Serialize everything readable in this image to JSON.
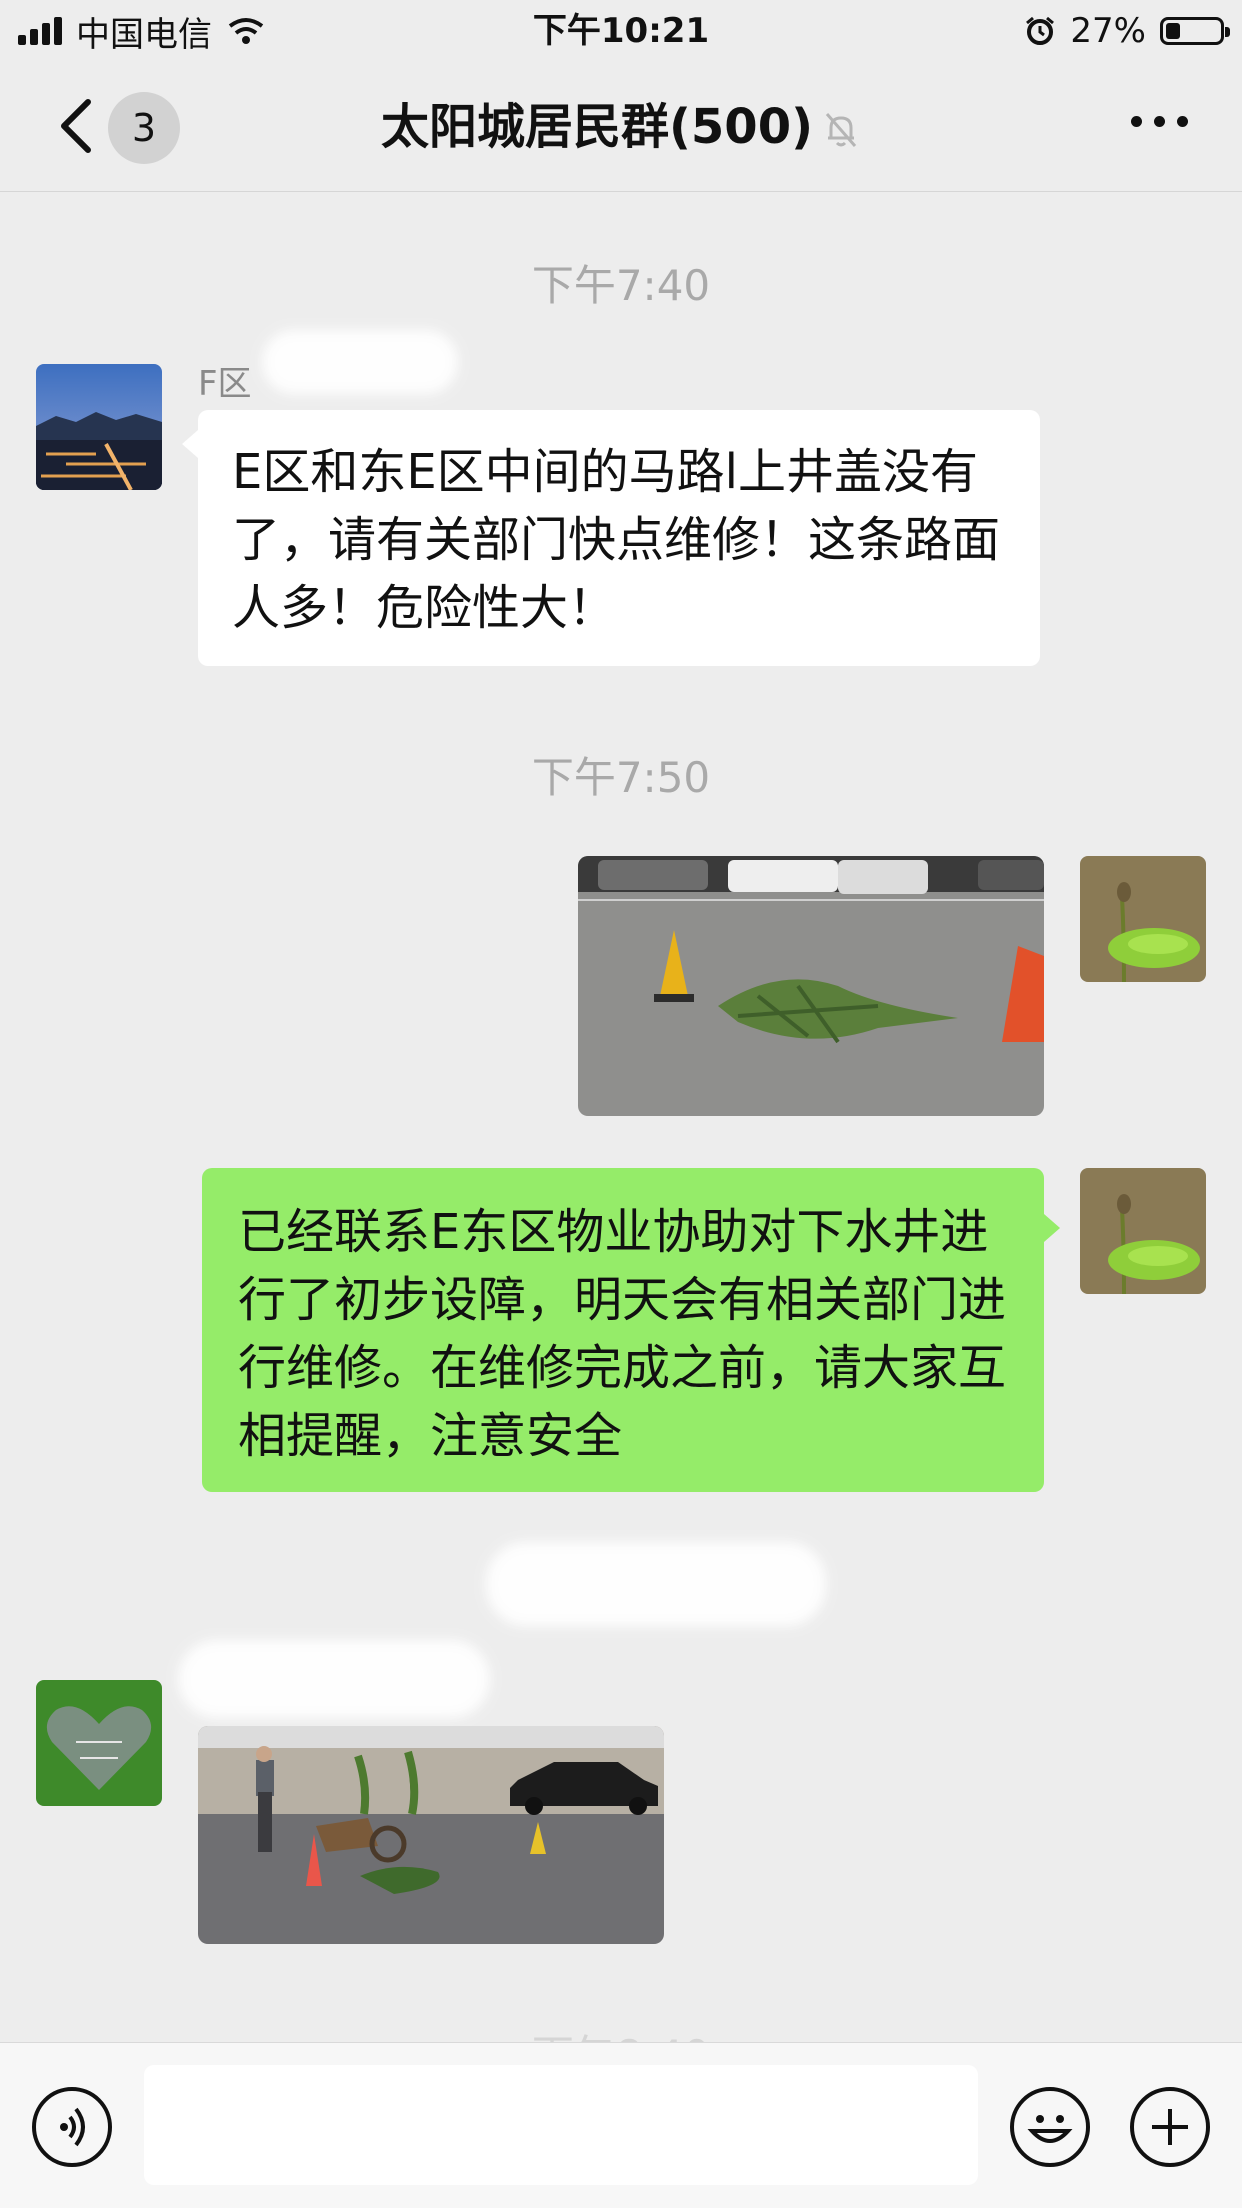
{
  "status_bar": {
    "carrier": "中国电信",
    "time": "下午10:21",
    "battery": "27%",
    "battery_level": 0.27
  },
  "nav": {
    "back_badge": "3",
    "title": "太阳城居民群(500)"
  },
  "messages": {
    "ts1": "下午7:40",
    "msg1_sender": "F区",
    "msg1_text": "E区和东E区中间的马路l上井盖没有了，请有关部门快点维修！这条路面人多！危险性大！",
    "ts2": "下午7:50",
    "msg3_text": "已经联系E东区物业协助对下水井进行了初步设障，明天会有相关部门进行维修。在维修完成之前，请大家互相提醒，注意安全"
  },
  "icons": {
    "back": "chevron-left-icon",
    "mute": "bell-slash-icon",
    "more": "more-dots-icon",
    "voice": "voice-icon",
    "emoji": "emoji-icon",
    "plus": "plus-icon"
  },
  "colors": {
    "background": "#ededed",
    "self_bubble": "#95ec69",
    "other_bubble": "#ffffff",
    "timestamp": "#a9a9a9"
  }
}
